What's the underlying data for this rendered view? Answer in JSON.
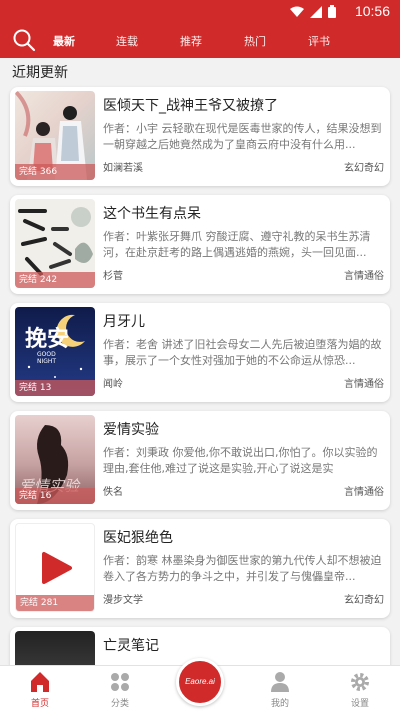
{
  "status_bar": {
    "time": "10:56"
  },
  "nav": {
    "tabs": [
      {
        "label": "最新",
        "active": true
      },
      {
        "label": "连载",
        "active": false
      },
      {
        "label": "推荐",
        "active": false
      },
      {
        "label": "热门",
        "active": false
      },
      {
        "label": "评书",
        "active": false
      }
    ]
  },
  "section_title": "近期更新",
  "books": [
    {
      "title": "医倾天下_战神王爷又被撩了",
      "desc": "作者：小宇 云轻歌在现代是医毒世家的传人，结果没想到一朝穿越之后她竟然成为了皇商云府中没有什么用...",
      "author": "如澜若溪",
      "genre": "玄幻奇幻",
      "status": "完结 366"
    },
    {
      "title": "这个书生有点呆",
      "desc": "作者：叶紫张牙舞爪 穷酸迂腐、遵守礼教的呆书生苏清河，在赴京赶考的路上偶遇逃婚的燕婉，头一回见面...",
      "author": "杉菅",
      "genre": "言情通俗",
      "status": "完结 242"
    },
    {
      "title": "月牙儿",
      "desc": "作者：老舍 讲述了旧社会母女二人先后被迫堕落为娼的故事，展示了一个女性对强加于她的不公命运从惊恐...",
      "author": "闻岭",
      "genre": "言情通俗",
      "status": "完结 13"
    },
    {
      "title": "爱情实验",
      "desc": "作者：刘秉政 你爱他,你不敢说出口,你怕了。你以实验的理由,套住他,难过了说这是实验,开心了说这是实",
      "author": "佚名",
      "genre": "言情通俗",
      "status": "完结 16"
    },
    {
      "title": "医妃狠绝色",
      "desc": "作者：韵寒 林墨染身为御医世家的第九代传人却不想被迫卷入了各方势力的争斗之中，并引发了与傀儡皇帝...",
      "author": "漫步文学",
      "genre": "玄幻奇幻",
      "status": "完结 281"
    },
    {
      "title": "亡灵笔记",
      "desc": "",
      "author": "",
      "genre": "",
      "status": ""
    }
  ],
  "cover_texts": {
    "book3_a": "挽安",
    "book3_b": "GOOD NIGHT",
    "book4": "爱情实验"
  },
  "tabbar": {
    "items": [
      {
        "label": "首页",
        "active": true
      },
      {
        "label": "分类"
      },
      {
        "label": "我的"
      },
      {
        "label": "设置"
      }
    ],
    "center_label": "Eaore.ai"
  },
  "colors": {
    "accent": "#d12a2a"
  }
}
